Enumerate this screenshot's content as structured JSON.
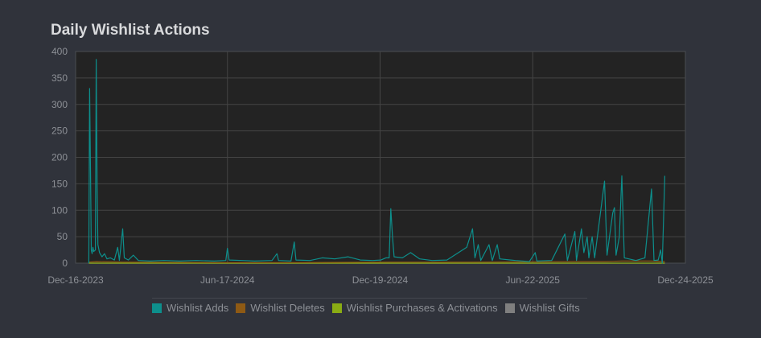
{
  "title": "Daily Wishlist Actions",
  "legend": [
    {
      "label": "Wishlist Adds",
      "color": "#0d8f8c"
    },
    {
      "label": "Wishlist Deletes",
      "color": "#8e5a14"
    },
    {
      "label": "Wishlist Purchases & Activations",
      "color": "#8aac14"
    },
    {
      "label": "Wishlist Gifts",
      "color": "#7f7f7f"
    }
  ],
  "chart_data": {
    "type": "line",
    "title": "Daily Wishlist Actions",
    "xlabel": "",
    "ylabel": "",
    "ylim": [
      0,
      400
    ],
    "yticks": [
      0,
      50,
      100,
      150,
      200,
      250,
      300,
      350,
      400
    ],
    "xlim": [
      "2023-12-16",
      "2025-12-24"
    ],
    "xticks": [
      "Dec-16-2023",
      "Jun-17-2024",
      "Dec-19-2024",
      "Jun-22-2025",
      "Dec-24-2025"
    ],
    "grid": true,
    "legend_position": "bottom",
    "series": [
      {
        "name": "Wishlist Adds",
        "color": "#0d8f8c",
        "points": [
          [
            "2024-01-01",
            0
          ],
          [
            "2024-01-02",
            330
          ],
          [
            "2024-01-03",
            175
          ],
          [
            "2024-01-04",
            25
          ],
          [
            "2024-01-05",
            18
          ],
          [
            "2024-01-06",
            30
          ],
          [
            "2024-01-07",
            22
          ],
          [
            "2024-01-09",
            25
          ],
          [
            "2024-01-10",
            385
          ],
          [
            "2024-01-11",
            150
          ],
          [
            "2024-01-12",
            35
          ],
          [
            "2024-01-14",
            20
          ],
          [
            "2024-01-17",
            12
          ],
          [
            "2024-01-20",
            18
          ],
          [
            "2024-01-23",
            8
          ],
          [
            "2024-01-27",
            10
          ],
          [
            "2024-02-01",
            6
          ],
          [
            "2024-02-05",
            30
          ],
          [
            "2024-02-07",
            5
          ],
          [
            "2024-02-11",
            65
          ],
          [
            "2024-02-13",
            10
          ],
          [
            "2024-02-18",
            6
          ],
          [
            "2024-02-24",
            15
          ],
          [
            "2024-03-01",
            5
          ],
          [
            "2024-03-15",
            4
          ],
          [
            "2024-04-01",
            5
          ],
          [
            "2024-04-20",
            4
          ],
          [
            "2024-05-10",
            5
          ],
          [
            "2024-06-01",
            4
          ],
          [
            "2024-06-15",
            5
          ],
          [
            "2024-06-17",
            28
          ],
          [
            "2024-06-19",
            6
          ],
          [
            "2024-07-05",
            5
          ],
          [
            "2024-07-20",
            4
          ],
          [
            "2024-08-10",
            5
          ],
          [
            "2024-08-16",
            18
          ],
          [
            "2024-08-18",
            5
          ],
          [
            "2024-09-02",
            4
          ],
          [
            "2024-09-06",
            40
          ],
          [
            "2024-09-08",
            6
          ],
          [
            "2024-09-25",
            5
          ],
          [
            "2024-10-10",
            10
          ],
          [
            "2024-10-25",
            8
          ],
          [
            "2024-11-10",
            12
          ],
          [
            "2024-11-25",
            6
          ],
          [
            "2024-12-10",
            5
          ],
          [
            "2024-12-20",
            6
          ],
          [
            "2024-12-26",
            10
          ],
          [
            "2024-12-30",
            10
          ],
          [
            "2025-01-01",
            103
          ],
          [
            "2025-01-03",
            50
          ],
          [
            "2025-01-05",
            12
          ],
          [
            "2025-01-15",
            10
          ],
          [
            "2025-01-25",
            20
          ],
          [
            "2025-02-05",
            8
          ],
          [
            "2025-02-20",
            5
          ],
          [
            "2025-03-10",
            6
          ],
          [
            "2025-04-03",
            30
          ],
          [
            "2025-04-10",
            65
          ],
          [
            "2025-04-13",
            10
          ],
          [
            "2025-04-17",
            35
          ],
          [
            "2025-04-20",
            5
          ],
          [
            "2025-04-30",
            35
          ],
          [
            "2025-05-04",
            5
          ],
          [
            "2025-05-10",
            35
          ],
          [
            "2025-05-13",
            8
          ],
          [
            "2025-06-01",
            5
          ],
          [
            "2025-06-18",
            3
          ],
          [
            "2025-06-25",
            20
          ],
          [
            "2025-06-27",
            4
          ],
          [
            "2025-07-15",
            5
          ],
          [
            "2025-07-31",
            55
          ],
          [
            "2025-08-03",
            5
          ],
          [
            "2025-08-12",
            60
          ],
          [
            "2025-08-14",
            5
          ],
          [
            "2025-08-20",
            65
          ],
          [
            "2025-08-23",
            20
          ],
          [
            "2025-08-27",
            50
          ],
          [
            "2025-08-29",
            10
          ],
          [
            "2025-09-02",
            50
          ],
          [
            "2025-09-05",
            10
          ],
          [
            "2025-09-17",
            155
          ],
          [
            "2025-09-20",
            15
          ],
          [
            "2025-09-27",
            95
          ],
          [
            "2025-09-29",
            105
          ],
          [
            "2025-10-01",
            15
          ],
          [
            "2025-10-05",
            50
          ],
          [
            "2025-10-08",
            165
          ],
          [
            "2025-10-11",
            10
          ],
          [
            "2025-10-25",
            5
          ],
          [
            "2025-11-05",
            10
          ],
          [
            "2025-11-13",
            140
          ],
          [
            "2025-11-16",
            5
          ],
          [
            "2025-11-21",
            6
          ],
          [
            "2025-11-24",
            25
          ],
          [
            "2025-11-26",
            0
          ],
          [
            "2025-11-29",
            165
          ]
        ]
      },
      {
        "name": "Wishlist Deletes",
        "color": "#8e5a14",
        "points": [
          [
            "2024-01-01",
            2
          ],
          [
            "2024-01-10",
            3
          ],
          [
            "2024-02-11",
            2
          ],
          [
            "2024-06-17",
            1
          ],
          [
            "2024-09-06",
            1
          ],
          [
            "2025-01-01",
            2
          ],
          [
            "2025-04-10",
            2
          ],
          [
            "2025-08-20",
            3
          ],
          [
            "2025-09-17",
            3
          ],
          [
            "2025-10-08",
            4
          ],
          [
            "2025-11-13",
            4
          ],
          [
            "2025-11-29",
            3
          ]
        ]
      },
      {
        "name": "Wishlist Purchases & Activations",
        "color": "#8aac14",
        "points": [
          [
            "2024-01-01",
            0
          ],
          [
            "2024-06-17",
            0
          ],
          [
            "2025-01-01",
            0
          ],
          [
            "2025-06-22",
            0
          ],
          [
            "2025-11-29",
            0
          ]
        ]
      },
      {
        "name": "Wishlist Gifts",
        "color": "#7f7f7f",
        "points": [
          [
            "2024-01-01",
            0
          ],
          [
            "2024-06-17",
            0
          ],
          [
            "2025-01-01",
            0
          ],
          [
            "2025-06-22",
            0
          ],
          [
            "2025-11-29",
            0
          ]
        ]
      }
    ]
  }
}
